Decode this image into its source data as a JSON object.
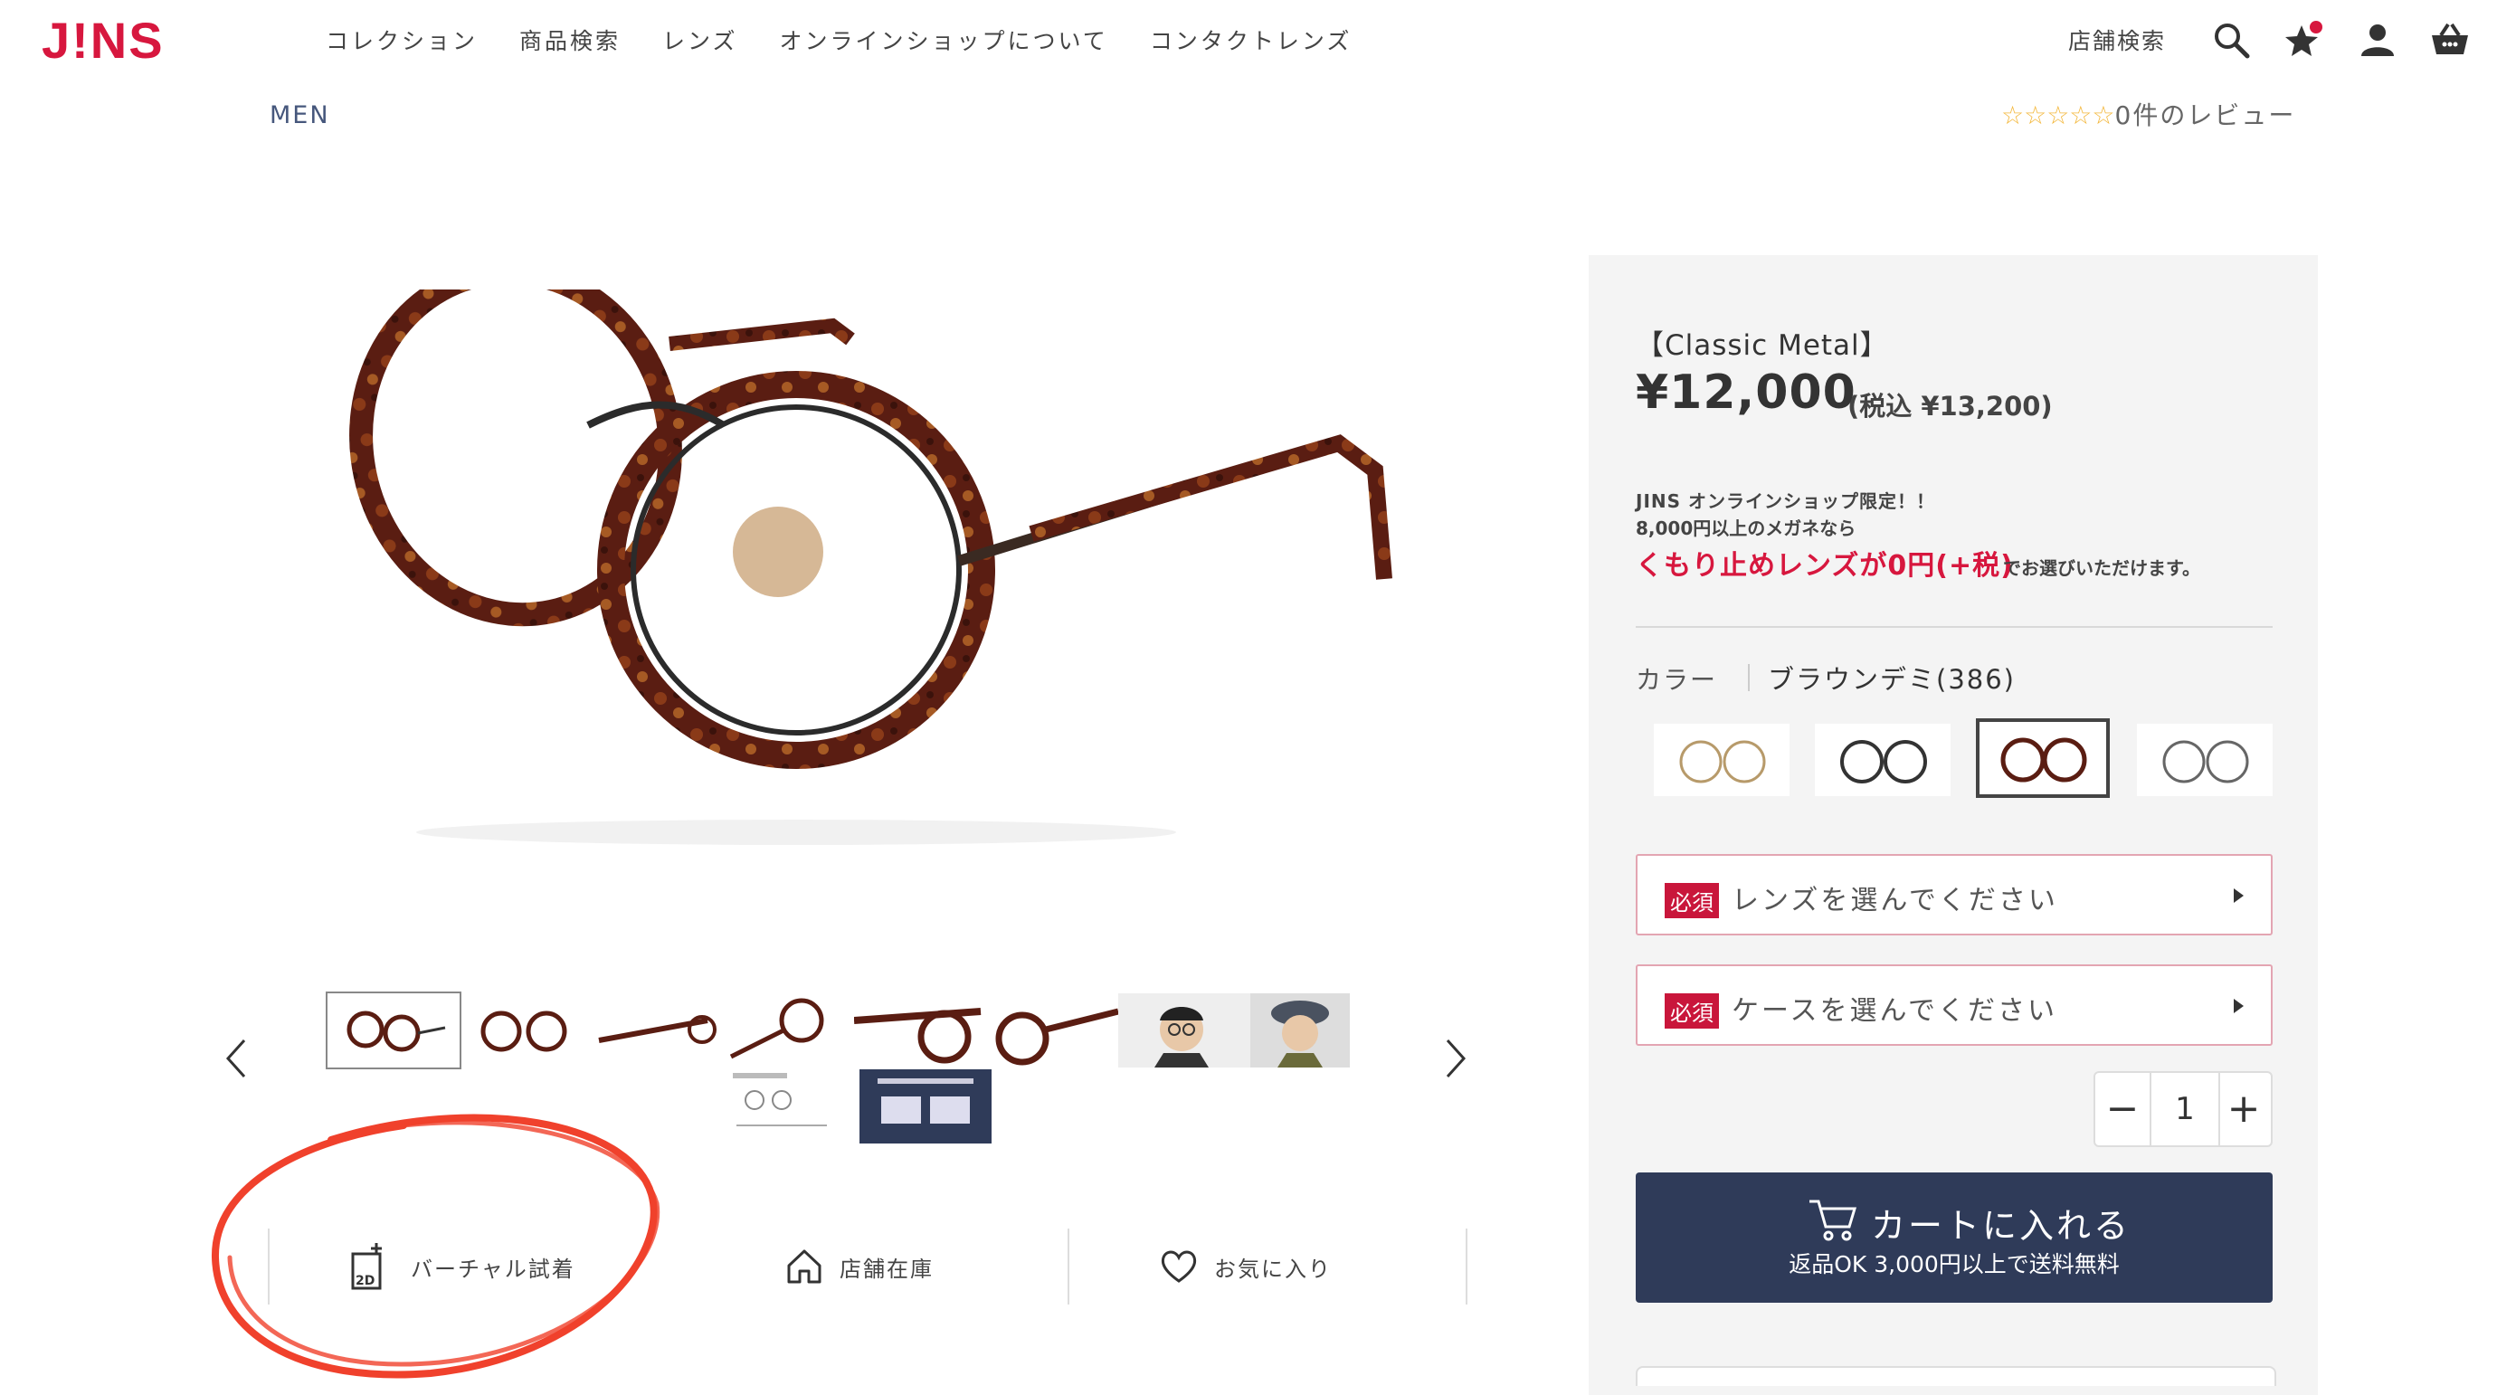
{
  "header": {
    "logo": "J!NS",
    "nav": [
      "コレクション",
      "商品検索",
      "レンズ",
      "オンラインショップについて",
      "コンタクトレンズ"
    ],
    "store_search": "店舗検索",
    "icons": [
      "search-icon",
      "favorites-star-icon",
      "account-icon",
      "cart-basket-icon"
    ],
    "brand_color": "#d7173e"
  },
  "breadcrumb": "MEN",
  "review": {
    "stars": "☆☆☆☆☆",
    "text": "0件のレビュー"
  },
  "product": {
    "series": "【Classic Metal】",
    "price": "¥12,000",
    "tax_price": "(税込 ¥13,200)",
    "promo_line1": "JINS オンラインショップ限定！！",
    "promo_line2": "8,000円以上のメガネなら",
    "promo_highlight": "くもり止めレンズが0円(+税)",
    "promo_suffix": "でお選びいただけます。",
    "color_label": "カラー",
    "color_name": "ブラウンデミ(386)",
    "selected_swatch_index": 2,
    "lens_required": "必須",
    "lens_select": "レンズを選んでください",
    "case_required": "必須",
    "case_select": "ケースを選んでください",
    "quantity": "1",
    "minus": "−",
    "plus": "+",
    "cart_label": "カートに入れる",
    "cart_sub": "返品OK 3,000円以上で送料無料"
  },
  "actions": [
    {
      "label": "バーチャル試着",
      "icon": "virtual-try-on-2d-icon"
    },
    {
      "label": "店舗在庫",
      "icon": "store-home-icon"
    },
    {
      "label": "お気に入り",
      "icon": "heart-icon"
    }
  ],
  "annotation_color": "#f0412c",
  "accent_navy": "#2f3b59"
}
